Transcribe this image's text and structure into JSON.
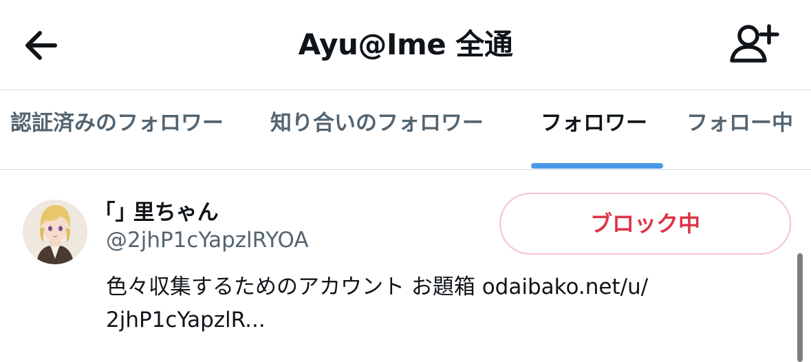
{
  "header": {
    "title": "Ayu@Ime 全通",
    "back_icon": "arrow-left-icon",
    "follow_icon": "person-add-icon"
  },
  "tabs": [
    {
      "label": "認証済みのフォロワー",
      "active": false
    },
    {
      "label": "知り合いのフォロワー",
      "active": false
    },
    {
      "label": "フォロワー",
      "active": true
    },
    {
      "label": "フォロー中",
      "active": false
    }
  ],
  "users": [
    {
      "name": "｢｣ 里ちゃん",
      "handle": "@2jhP1cYapzlRYOA",
      "bio_line1": "色々収集するためのアカウント お題箱 odaibako.net/u/",
      "bio_line2": "2jhP1cYapzlR...",
      "action_label": "ブロック中"
    }
  ],
  "colors": {
    "accent": "#4a99e9",
    "block_text": "#dc3545",
    "block_border": "#f4c4c9",
    "secondary_text": "#536471"
  }
}
